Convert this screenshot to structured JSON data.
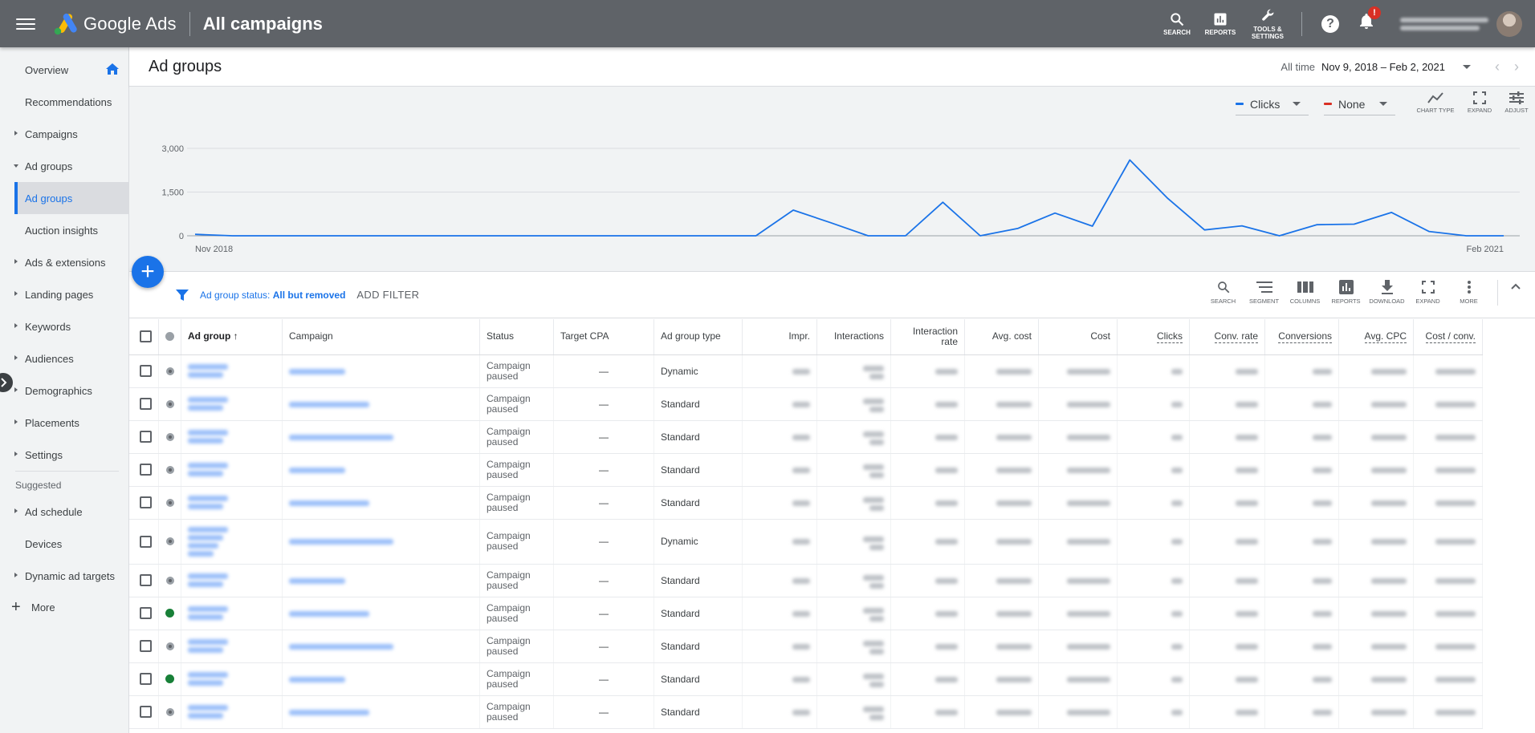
{
  "topbar": {
    "brand": "Google Ads",
    "heading": "All campaigns",
    "actions": [
      {
        "label": "SEARCH",
        "icon": "search-icon"
      },
      {
        "label": "REPORTS",
        "icon": "reports-icon"
      },
      {
        "label": "TOOLS & SETTINGS",
        "icon": "wrench-icon"
      }
    ],
    "help": "?",
    "notification_badge": "!"
  },
  "sidebar": {
    "items": [
      {
        "label": "Overview",
        "caret": "none"
      },
      {
        "label": "Recommendations",
        "caret": "none"
      },
      {
        "label": "Campaigns",
        "caret": "right"
      },
      {
        "label": "Ad groups",
        "caret": "down"
      },
      {
        "label": "Ad groups",
        "sub": true,
        "active": true
      },
      {
        "label": "Auction insights",
        "sub": true
      },
      {
        "label": "Ads & extensions",
        "caret": "right"
      },
      {
        "label": "Landing pages",
        "caret": "right"
      },
      {
        "label": "Keywords",
        "caret": "right"
      },
      {
        "label": "Audiences",
        "caret": "right"
      },
      {
        "label": "Demographics",
        "caret": "right"
      },
      {
        "label": "Placements",
        "caret": "right"
      },
      {
        "label": "Settings",
        "caret": "right"
      }
    ],
    "suggested_heading": "Suggested",
    "suggested": [
      {
        "label": "Ad schedule",
        "caret": "right"
      },
      {
        "label": "Devices",
        "caret": "none"
      },
      {
        "label": "Dynamic ad targets",
        "caret": "right"
      }
    ],
    "more": "More"
  },
  "main": {
    "title": "Ad groups",
    "date_label": "All time",
    "date_range": "Nov 9, 2018 – Feb 2, 2021"
  },
  "chart_controls": {
    "metric1": "Clicks",
    "metric2": "None",
    "tools": [
      "CHART TYPE",
      "EXPAND",
      "ADJUST"
    ]
  },
  "chart_data": {
    "type": "line",
    "series": [
      {
        "name": "Clicks",
        "color": "#1a73e8",
        "values": [
          50,
          0,
          0,
          0,
          0,
          0,
          0,
          0,
          0,
          0,
          0,
          0,
          0,
          0,
          0,
          0,
          880,
          450,
          0,
          0,
          1150,
          0,
          250,
          780,
          330,
          2600,
          1300,
          200,
          340,
          0,
          380,
          400,
          800,
          150,
          0,
          0
        ]
      }
    ],
    "x_tick_labels": [
      "Nov 2018",
      "Feb 2021"
    ],
    "y_ticks": [
      0,
      1500,
      3000
    ],
    "y_tick_labels": [
      "0",
      "1,500",
      "3,000"
    ],
    "ylim": [
      0,
      3000
    ],
    "grid": true
  },
  "filter": {
    "label": "Ad group status:",
    "value": "All but removed",
    "add_filter": "ADD FILTER"
  },
  "table_tools": [
    "SEARCH",
    "SEGMENT",
    "COLUMNS",
    "REPORTS",
    "DOWNLOAD",
    "EXPAND",
    "MORE"
  ],
  "table": {
    "columns": [
      "Ad group",
      "Campaign",
      "Status",
      "Target CPA",
      "Ad group type",
      "Impr.",
      "Interactions",
      "Interaction rate",
      "Avg. cost",
      "Cost",
      "Clicks",
      "Conv. rate",
      "Conversions",
      "Avg. CPC",
      "Cost / conv."
    ],
    "rows": [
      {
        "status_dot": "grey",
        "status": "Campaign paused",
        "target_cpa": "—",
        "type": "Dynamic",
        "tall": false
      },
      {
        "status_dot": "grey",
        "status": "Campaign paused",
        "target_cpa": "—",
        "type": "Standard",
        "tall": false
      },
      {
        "status_dot": "grey",
        "status": "Campaign paused",
        "target_cpa": "—",
        "type": "Standard",
        "tall": false
      },
      {
        "status_dot": "grey",
        "status": "Campaign paused",
        "target_cpa": "—",
        "type": "Standard",
        "tall": false
      },
      {
        "status_dot": "grey",
        "status": "Campaign paused",
        "target_cpa": "—",
        "type": "Standard",
        "tall": false
      },
      {
        "status_dot": "grey",
        "status": "Campaign paused",
        "target_cpa": "—",
        "type": "Dynamic",
        "tall": true
      },
      {
        "status_dot": "grey",
        "status": "Campaign paused",
        "target_cpa": "—",
        "type": "Standard",
        "tall": false
      },
      {
        "status_dot": "green",
        "status": "Campaign paused",
        "target_cpa": "—",
        "type": "Standard",
        "tall": false
      },
      {
        "status_dot": "grey",
        "status": "Campaign paused",
        "target_cpa": "—",
        "type": "Standard",
        "tall": false
      },
      {
        "status_dot": "green",
        "status": "Campaign paused",
        "target_cpa": "—",
        "type": "Standard",
        "tall": false
      },
      {
        "status_dot": "grey",
        "status": "Campaign paused",
        "target_cpa": "—",
        "type": "Standard",
        "tall": false
      }
    ]
  },
  "colors": {
    "topbar": "#5f6368",
    "accent": "#1a73e8",
    "series2": "#d93025",
    "active_status": "#188038"
  }
}
